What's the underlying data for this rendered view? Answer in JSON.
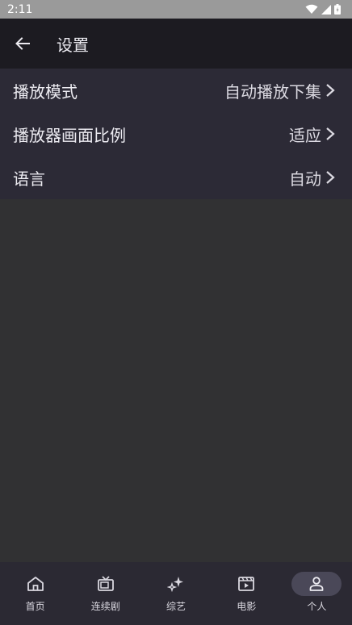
{
  "status": {
    "time": "2:11"
  },
  "appbar": {
    "title": "设置"
  },
  "settings": [
    {
      "label": "播放模式",
      "value": "自动播放下集"
    },
    {
      "label": "播放器画面比例",
      "value": "适应"
    },
    {
      "label": "语言",
      "value": "自动"
    }
  ],
  "nav": [
    {
      "label": "首页",
      "icon": "home-icon"
    },
    {
      "label": "连续剧",
      "icon": "tv-icon"
    },
    {
      "label": "综艺",
      "icon": "sparkle-icon"
    },
    {
      "label": "电影",
      "icon": "movie-icon"
    },
    {
      "label": "个人",
      "icon": "person-icon",
      "active": true
    }
  ],
  "colors": {
    "accent_pill": "#4a4858",
    "appbar": "#1c1b21",
    "list_bg": "#2c2a36"
  }
}
